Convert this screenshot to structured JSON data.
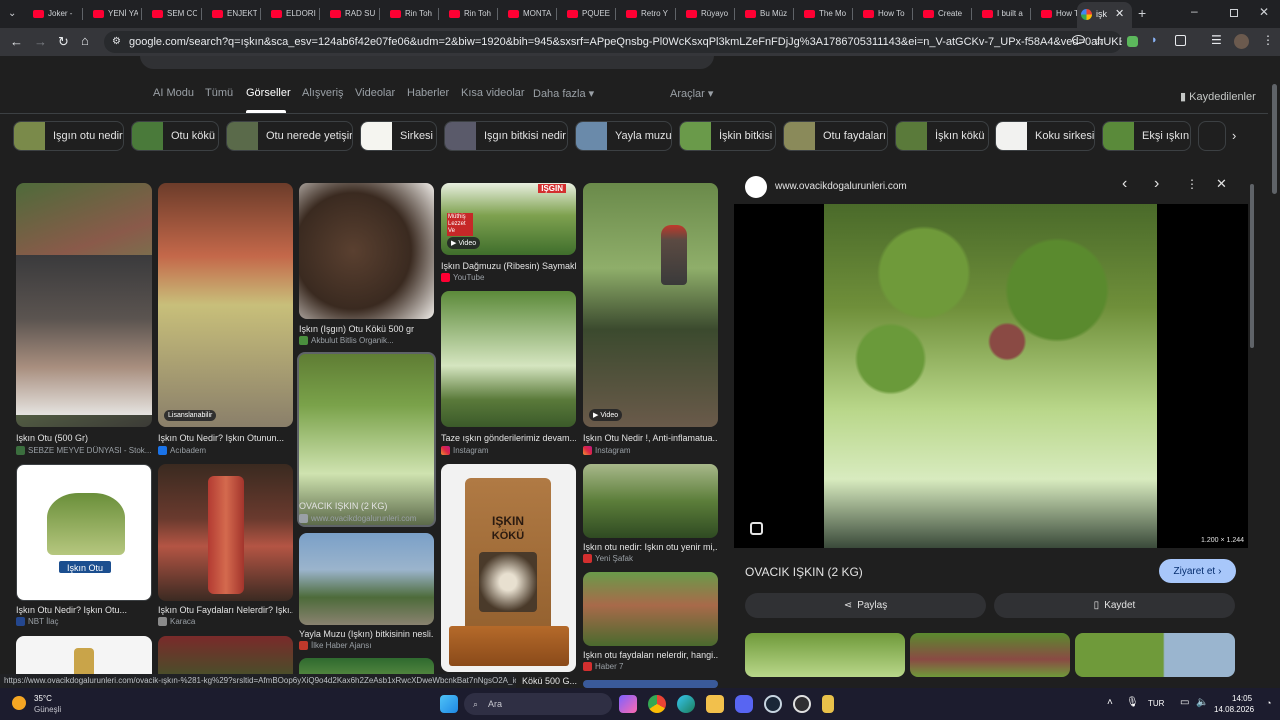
{
  "browser": {
    "tabs": [
      {
        "label": "Joker -",
        "type": "yt"
      },
      {
        "label": "YENİ YA",
        "type": "yt"
      },
      {
        "label": "SEM CO",
        "type": "yt"
      },
      {
        "label": "ENJEKTİ",
        "type": "yt"
      },
      {
        "label": "ELDORI",
        "type": "yt"
      },
      {
        "label": "RAD SU",
        "type": "yt"
      },
      {
        "label": "Rin Toh",
        "type": "yt"
      },
      {
        "label": "Rin Toh",
        "type": "yt"
      },
      {
        "label": "MONTA",
        "type": "yt"
      },
      {
        "label": "PQUEE",
        "type": "yt"
      },
      {
        "label": "Retro Y",
        "type": "yt"
      },
      {
        "label": "Rüyayo",
        "type": "yt"
      },
      {
        "label": "Bu Müz",
        "type": "yt"
      },
      {
        "label": "The Mo",
        "type": "yt"
      },
      {
        "label": "How To",
        "type": "yt"
      },
      {
        "label": "Create",
        "type": "yt"
      },
      {
        "label": "I built a",
        "type": "yt"
      },
      {
        "label": "How To",
        "type": "yt"
      }
    ],
    "active_tab_label": "işk",
    "url": "google.com/search?q=ışkın&sca_esv=124ab6f42e07fe06&udm=2&biw=1920&bih=945&sxsrf=APpeQnsbg-Pl0WcKsxqPl3kmLZeFnFDjJg%3A1786705311143&ei=n_V-atGCKv-7_UPx-f58A4&ved=0ahUKEwiR7I37-5-WAxUr_7sI..."
  },
  "search": {
    "nav_tabs": [
      "AI Modu",
      "Tümü",
      "Görseller",
      "Alışveriş",
      "Videolar",
      "Haberler",
      "Kısa videolar",
      "Daha fazla"
    ],
    "tools_label": "Araçlar",
    "saved_label": "Kaydedilenler",
    "chips": [
      "Işgın otu nedir",
      "Otu kökü",
      "Otu nerede yetişir",
      "Sirkesi",
      "Işgın bitkisi nedir",
      "Yayla muzu",
      "İşkin bitkisi",
      "Otu faydaları",
      "İşkın kökü",
      "Koku sirkesi",
      "Ekşi ışkın"
    ]
  },
  "results": {
    "col1": [
      {
        "caption": "Işkın Otu (500 Gr)",
        "source": "SEBZE MEYVE DÜNYASI - Stok..."
      },
      {
        "caption": "Işkın Otu Nedir? Işkın Otu...",
        "source": "NBT İlaç",
        "overlay": "Işkın Otu"
      }
    ],
    "col2": [
      {
        "caption": "Işkın Otu Nedir? Işkın Otunun...",
        "source": "Acıbadem",
        "badge": "Lisanslanabilir"
      },
      {
        "caption": "Işkın Otu Faydaları Nelerdir? Işkı...",
        "source": "Karaca"
      }
    ],
    "col3": [
      {
        "caption": "Işkın (Işgın) Otu Kökü 500 gr",
        "source": "Akbulut Bitlis Organik..."
      },
      {
        "caption": "OVACIK IŞKIN (2 KG)",
        "source": "www.ovacikdogalurunleri.com"
      },
      {
        "caption": "Yayla Muzu (Işkın) bitkisinin nesli...",
        "source": "İlke Haber Ajansı"
      }
    ],
    "col4": [
      {
        "caption": "Işkın Dağmuzu (Ribesin) Saymakl...",
        "source": "YouTube",
        "badge": "Video",
        "label_top": "IŞGIN",
        "label_left": "Müthiş Lezzet Ve"
      },
      {
        "caption": "Taze ışkın gönderilerimiz devam...",
        "source": "Instagram"
      },
      {
        "caption": "Kökü 500 G...",
        "source": "",
        "package_title": "IŞKIN",
        "package_sub": "KÖKÜ"
      }
    ],
    "col5": [
      {
        "caption": "Işkın Otu Nedir !, Anti-inflamatua...",
        "source": "Instagram",
        "badge": "Video"
      },
      {
        "caption": "Işkın otu nedir: Işkın otu yenir mi,...",
        "source": "Yeni Şafak"
      },
      {
        "caption": "Işkın otu faydaları nelerdir, hangi...",
        "source": "Haber 7"
      }
    ]
  },
  "preview": {
    "domain": "www.ovacikdogalurunleri.com",
    "dimensions": "1.200 × 1.244",
    "title": "OVACIK IŞKIN (2 KG)",
    "visit_label": "Ziyaret et",
    "share_label": "Paylaş",
    "save_label": "Kaydet"
  },
  "status_url": "https://www.ovacikdogalurunleri.com/ovacik-ışkın-%281-kg%29?srsltid=AfmBOop6yXiQ9o4d2Kax6h2ZeAsb1xRwcXDweWbcnkBat7nNgsO2A_io",
  "taskbar": {
    "weather_temp": "35°C",
    "weather_desc": "Güneşli",
    "search_placeholder": "Ara",
    "lang": "TUR",
    "time": "14:05",
    "date": "14.08.2026"
  },
  "colors": {
    "accent_blue": "#a8c7fa",
    "yt_red": "#ff0033",
    "page_bg": "#1f1f1f"
  }
}
